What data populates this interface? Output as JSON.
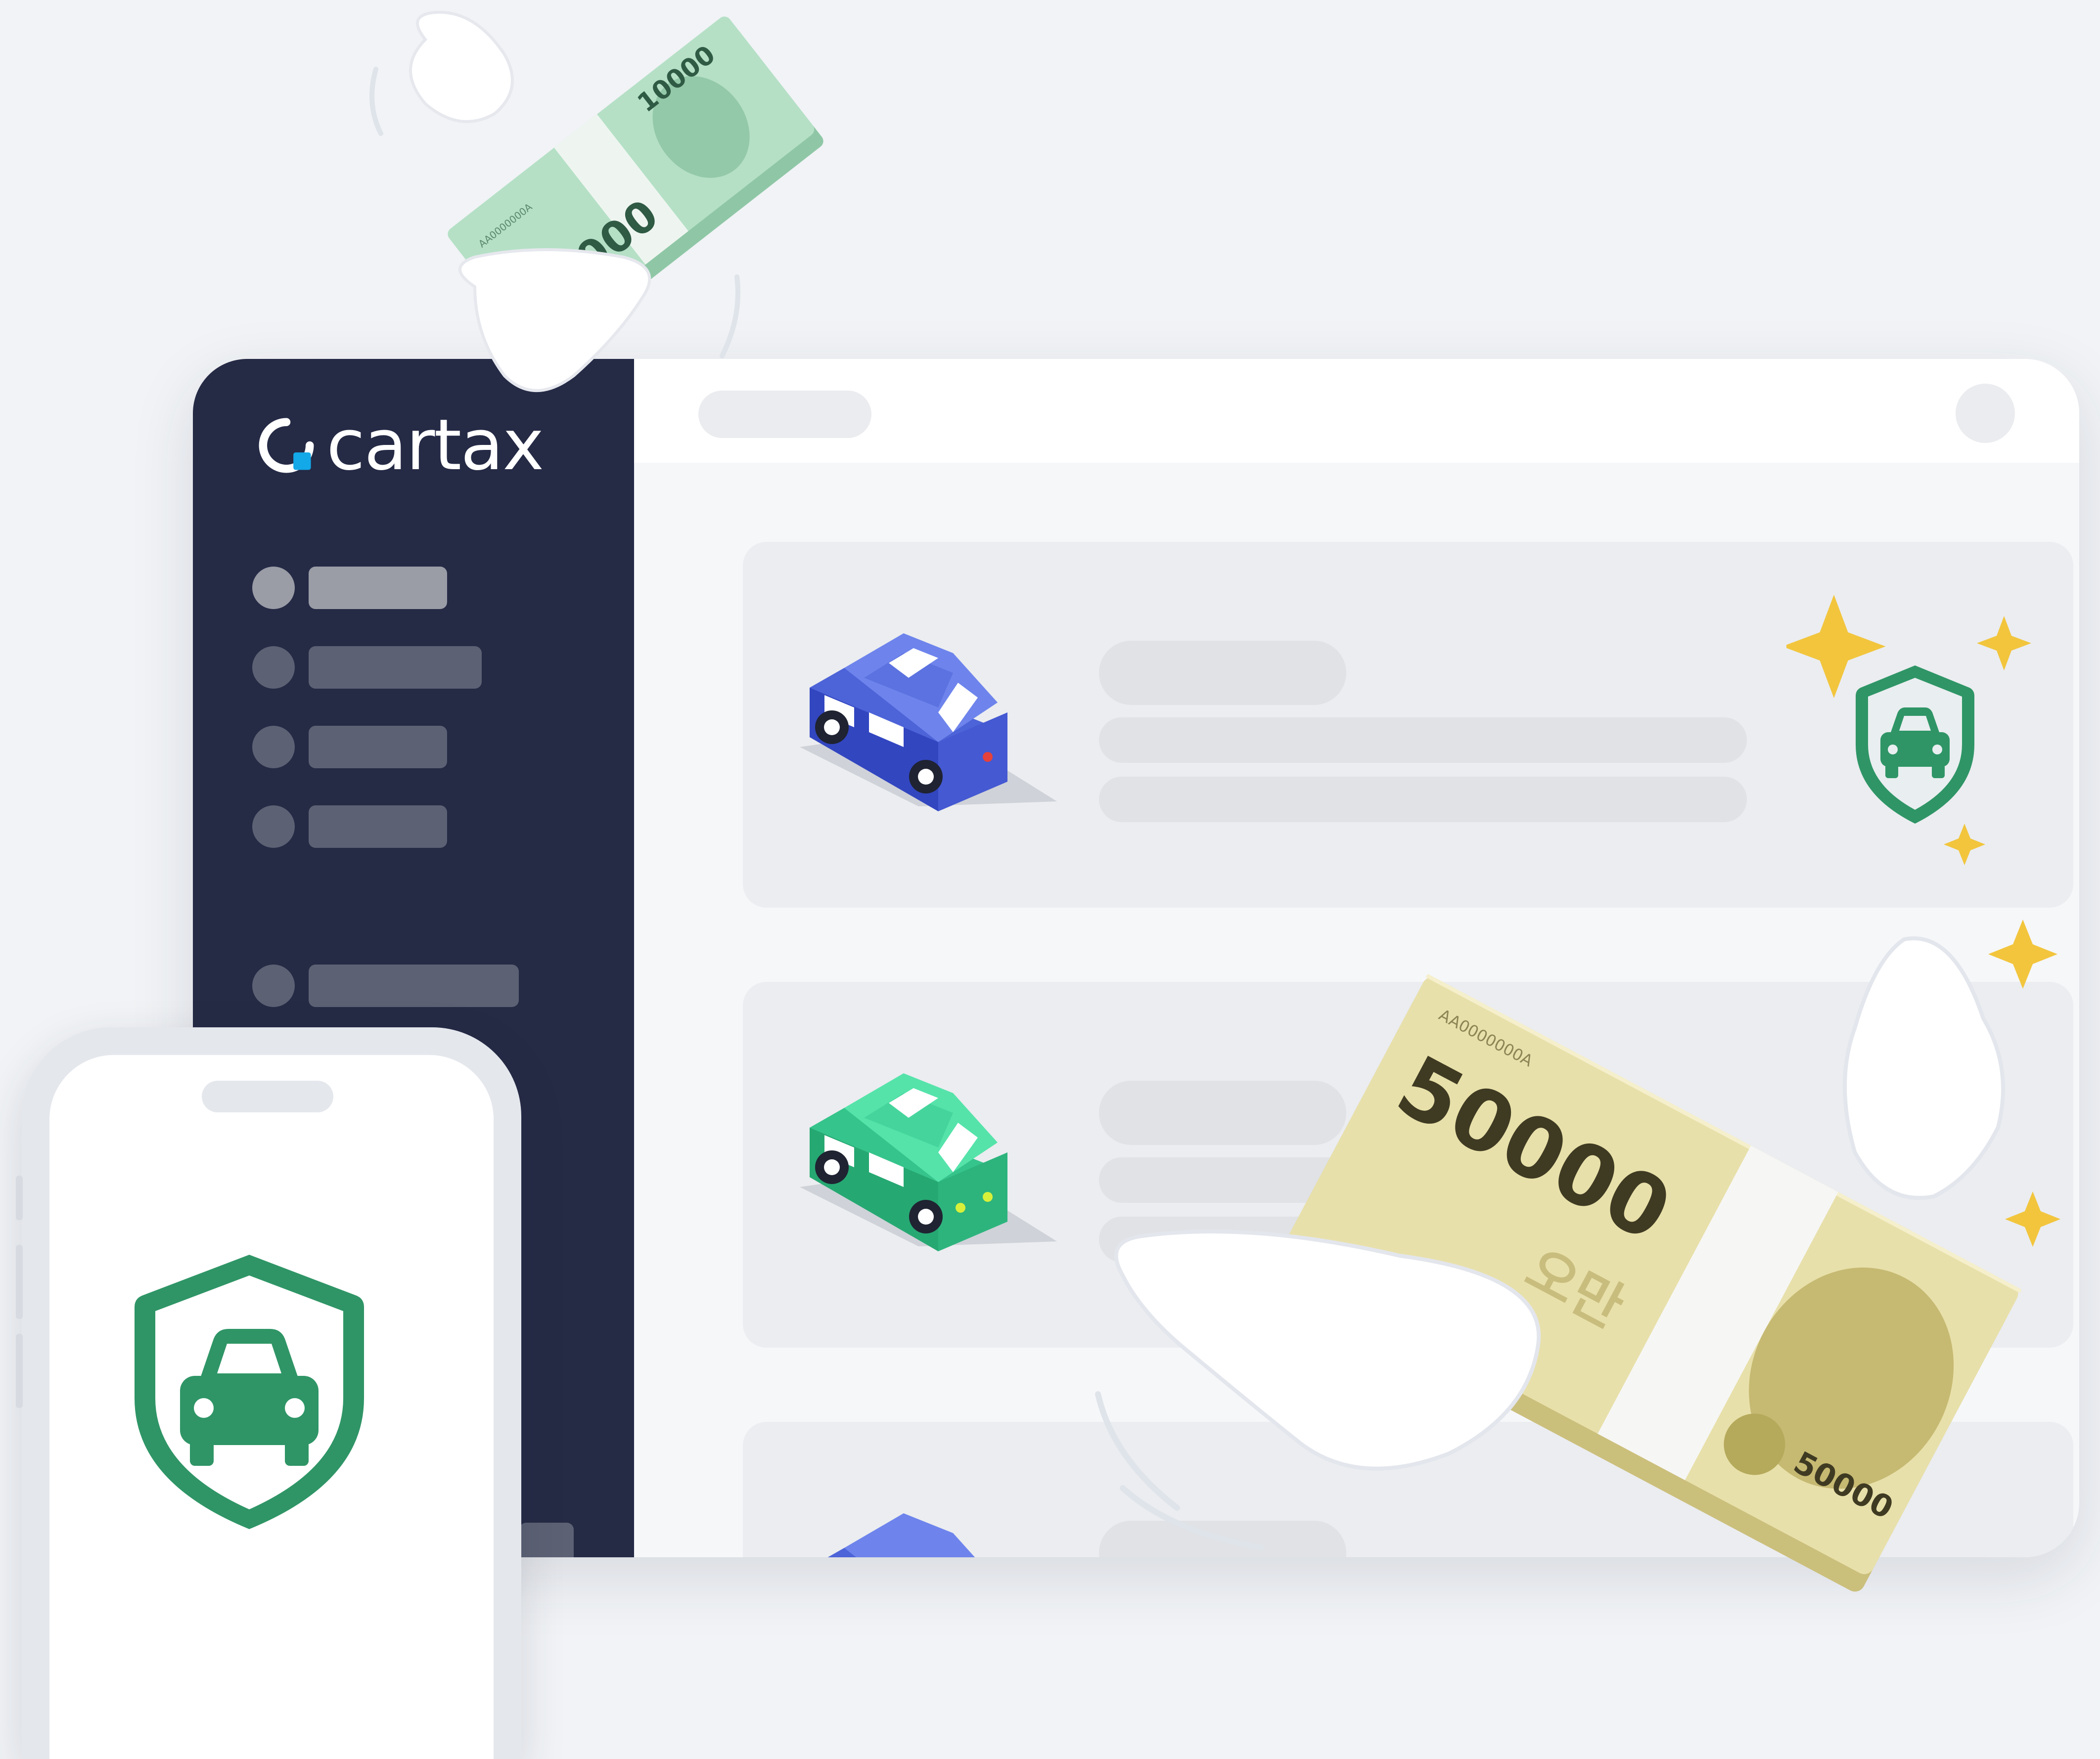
{
  "brand": {
    "name": "cartax",
    "accent": "#13a8e8",
    "sidebar_bg": "#252a45"
  },
  "sidebar": {
    "items": [
      {
        "icon": "menu-dot",
        "state": "active"
      },
      {
        "icon": "menu-dot",
        "state": "default"
      },
      {
        "icon": "menu-dot",
        "state": "default"
      },
      {
        "icon": "menu-dot",
        "state": "default"
      },
      {
        "icon": "menu-dot",
        "state": "default"
      }
    ]
  },
  "cards": [
    {
      "car_color": "#4d63d8",
      "badge": "car-shield-icon"
    },
    {
      "car_color": "#35c48b",
      "badge": ""
    },
    {
      "car_color": "#4d63d8",
      "badge": ""
    }
  ],
  "phone": {
    "badge": "car-shield-icon",
    "badge_color": "#2f9566"
  },
  "banknotes": {
    "small": {
      "amount": "10000",
      "serial": "AA0000000A",
      "color": "#a8d9bd"
    },
    "large": {
      "amount": "50000",
      "back_amount": "50000",
      "serial": "AA0000000A",
      "korean": "오만",
      "color": "#e8e0aa"
    }
  },
  "colors": {
    "sparkle": "#f2c53d",
    "shield": "#2f9566"
  }
}
